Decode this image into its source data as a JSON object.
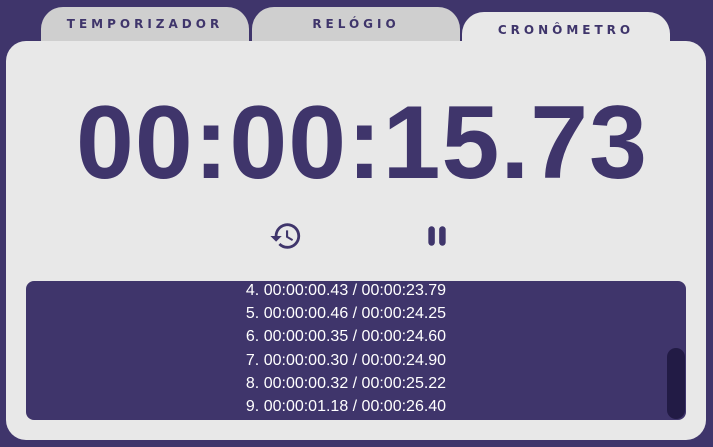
{
  "tabs": [
    {
      "label": "TEMPORIZADOR",
      "active": false
    },
    {
      "label": "RELÓGIO",
      "active": false
    },
    {
      "label": "CRONÔMETRO",
      "active": true
    }
  ],
  "stopwatch": {
    "time": "00:00:15.73"
  },
  "controls": {
    "reset_icon": "history-icon",
    "pause_icon": "pause-icon"
  },
  "laps": [
    "4. 00:00:00.43 / 00:00:23.79",
    "5. 00:00:00.46 / 00:00:24.25",
    "6. 00:00:00.35 / 00:00:24.60",
    "7. 00:00:00.30 / 00:00:24.90",
    "8. 00:00:00.32 / 00:00:25.22",
    "9. 00:00:01.18 / 00:00:26.40"
  ],
  "colors": {
    "background": "#3f356b",
    "panel": "#e8e8e8",
    "inactive_tab": "#cfcfcf",
    "scroll_thumb": "#221b45"
  }
}
